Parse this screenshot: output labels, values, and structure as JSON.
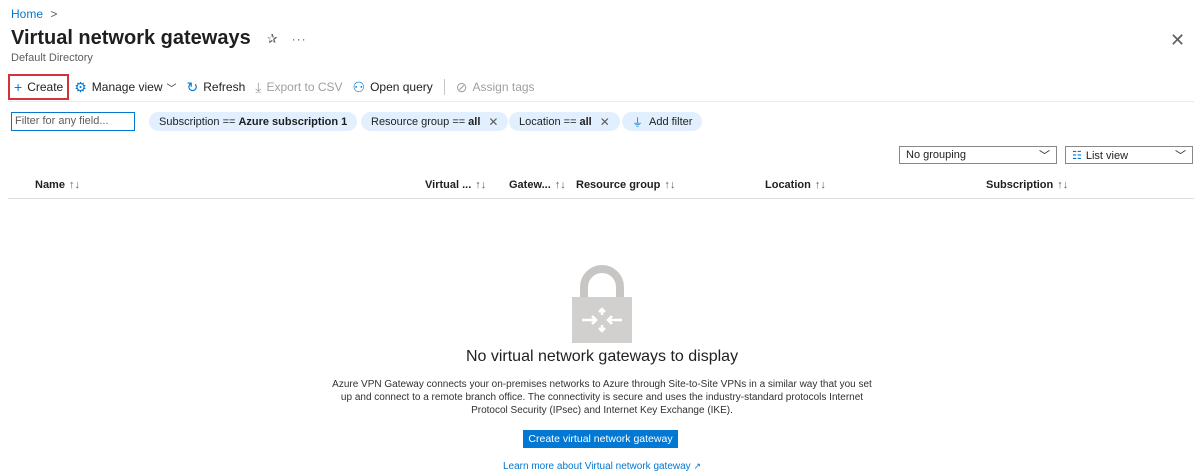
{
  "breadcrumb": {
    "home": "Home",
    "separator": ">"
  },
  "header": {
    "title": "Virtual network gateways",
    "pin_icon": "✰",
    "more": "···",
    "subtitle": "Default Directory",
    "close": "✕"
  },
  "toolbar": {
    "create": "Create",
    "manage_view": "Manage view",
    "refresh": "Refresh",
    "export_csv": "Export to CSV",
    "open_query": "Open query",
    "assign_tags": "Assign tags"
  },
  "filters": {
    "placeholder": "Filter for any field...",
    "subscription_label": "Subscription ==",
    "subscription_value": "Azure subscription 1",
    "resource_group_label": "Resource group ==",
    "resource_group_value": "all",
    "location_label": "Location ==",
    "location_value": "all",
    "add_filter": "Add filter"
  },
  "view": {
    "grouping": "No grouping",
    "list_view": "List view"
  },
  "columns": [
    {
      "label": "Name",
      "sort": "↑↓"
    },
    {
      "label": "Virtual ...",
      "sort": "↑↓"
    },
    {
      "label": "Gatew...",
      "sort": "↑↓"
    },
    {
      "label": "Resource group",
      "sort": "↑↓"
    },
    {
      "label": "Location",
      "sort": "↑↓"
    },
    {
      "label": "Subscription",
      "sort": "↑↓"
    }
  ],
  "empty_state": {
    "title": "No virtual network gateways to display",
    "description": "Azure VPN Gateway connects your on-premises networks to Azure through Site-to-Site VPNs in a similar way that you set up and connect to a remote branch office. The connectivity is secure and uses the industry-standard protocols Internet Protocol Security (IPsec) and Internet Key Exchange (IKE).",
    "create_button": "Create virtual network gateway",
    "learn_more": "Learn more about Virtual network gateway"
  },
  "colors": {
    "accent": "#0078d4",
    "highlight": "#d13438",
    "pill": "#e1efff"
  }
}
